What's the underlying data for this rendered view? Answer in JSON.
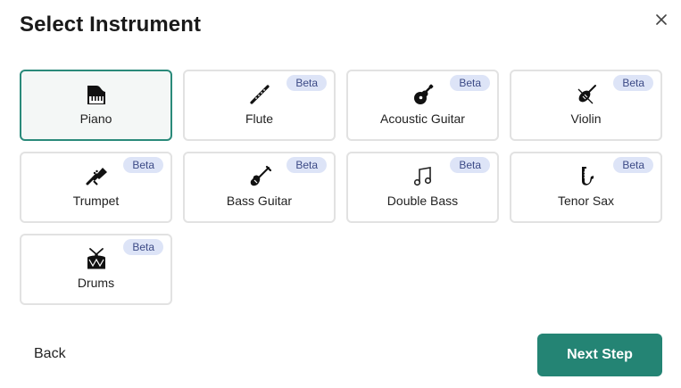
{
  "dialog": {
    "title": "Select Instrument",
    "close_icon": "close-icon"
  },
  "instruments": [
    {
      "label": "Piano",
      "icon": "piano-icon",
      "badge": "",
      "selected": true
    },
    {
      "label": "Flute",
      "icon": "flute-icon",
      "badge": "Beta",
      "selected": false
    },
    {
      "label": "Acoustic Guitar",
      "icon": "acoustic-guitar-icon",
      "badge": "Beta",
      "selected": false
    },
    {
      "label": "Violin",
      "icon": "violin-icon",
      "badge": "Beta",
      "selected": false
    },
    {
      "label": "Trumpet",
      "icon": "trumpet-icon",
      "badge": "Beta",
      "selected": false
    },
    {
      "label": "Bass Guitar",
      "icon": "bass-guitar-icon",
      "badge": "Beta",
      "selected": false
    },
    {
      "label": "Double Bass",
      "icon": "music-notes-icon",
      "badge": "Beta",
      "selected": false
    },
    {
      "label": "Tenor Sax",
      "icon": "saxophone-icon",
      "badge": "Beta",
      "selected": false
    },
    {
      "label": "Drums",
      "icon": "drum-icon",
      "badge": "Beta",
      "selected": false
    }
  ],
  "footer": {
    "back_label": "Back",
    "next_label": "Next Step"
  },
  "colors": {
    "accent": "#248474",
    "selected_border": "#2a8a7a",
    "badge_bg": "#dde4f7",
    "badge_text": "#3c4a86"
  }
}
